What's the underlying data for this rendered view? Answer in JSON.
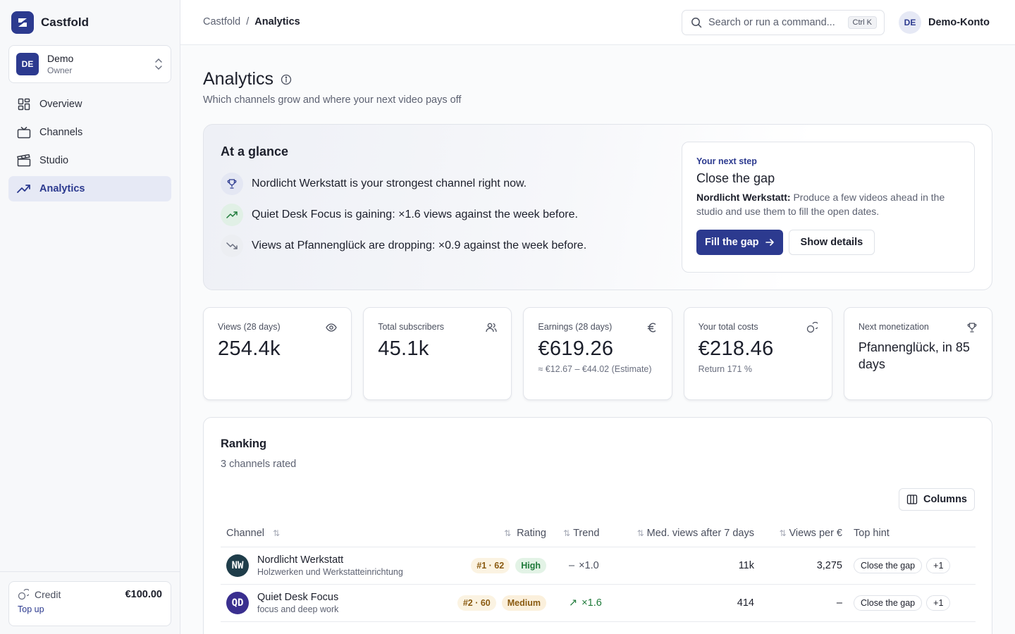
{
  "app": {
    "name": "Castfold",
    "brand_color": "#2c3a8f"
  },
  "workspace": {
    "initials": "DE",
    "name": "Demo",
    "role": "Owner"
  },
  "sidebar": {
    "items": [
      {
        "label": "Overview",
        "icon": "grid-icon"
      },
      {
        "label": "Channels",
        "icon": "tv-icon"
      },
      {
        "label": "Studio",
        "icon": "clapperboard-icon"
      },
      {
        "label": "Analytics",
        "icon": "trending-up-icon",
        "active": true
      }
    ]
  },
  "credit": {
    "label": "Credit",
    "amount": "€100.00",
    "topup": "Top up"
  },
  "breadcrumb": {
    "root": "Castfold",
    "separator": "/",
    "current": "Analytics"
  },
  "search": {
    "placeholder": "Search or run a command...",
    "shortcut": "Ctrl K"
  },
  "account": {
    "initials": "DE",
    "name": "Demo-Konto"
  },
  "page": {
    "title": "Analytics",
    "subtitle": "Which channels grow and where your next video pays off"
  },
  "glance": {
    "title": "At a glance",
    "items": [
      {
        "icon": "trophy-icon",
        "text": "Nordlicht Werkstatt is your strongest channel right now."
      },
      {
        "icon": "trending-up-icon",
        "text": "Quiet Desk Focus is gaining: ×1.6 views against the week before."
      },
      {
        "icon": "trending-down-icon",
        "text": "Views at Pfannenglück are dropping: ×0.9 against the week before."
      }
    ]
  },
  "next_step": {
    "kicker": "Your next step",
    "title": "Close the gap",
    "channel": "Nordlicht Werkstatt:",
    "body": "Produce a few videos ahead in the studio and use them to fill the open dates.",
    "primary": "Fill the gap",
    "secondary": "Show details"
  },
  "stats": [
    {
      "label": "Views (28 days)",
      "icon": "eye-icon",
      "value": "254.4k",
      "note": ""
    },
    {
      "label": "Total subscribers",
      "icon": "users-icon",
      "value": "45.1k",
      "note": ""
    },
    {
      "label": "Earnings (28 days)",
      "icon": "euro-icon",
      "value": "€619.26",
      "note": "≈ €12.67 – €44.02 (Estimate)"
    },
    {
      "label": "Your total costs",
      "icon": "coins-icon",
      "value": "€218.46",
      "note": "Return 171 %"
    },
    {
      "label": "Next monetization",
      "icon": "trophy-icon",
      "value": "Pfannenglück, in 85 days",
      "note": ""
    }
  ],
  "ranking": {
    "title": "Ranking",
    "subtitle": "3 channels rated",
    "columns_button": "Columns",
    "headers": {
      "channel": "Channel",
      "rating": "Rating",
      "trend": "Trend",
      "med_views": "Med. views after 7 days",
      "views_per_euro": "Views per €",
      "top_hint": "Top hint"
    },
    "rows": [
      {
        "initials": "NW",
        "avatar_color": "#1f3d4a",
        "name": "Nordlicht Werkstatt",
        "desc": "Holzwerken und Werkstatteinrichtung",
        "rank": "#1 · 62",
        "level": "High",
        "trend": "×1.0",
        "trend_dir": "flat",
        "med_views": "11k",
        "views_per_euro": "3,275",
        "hint": "Close the gap",
        "more": "+1"
      },
      {
        "initials": "QD",
        "avatar_color": "#3a2f8f",
        "name": "Quiet Desk Focus",
        "desc": "focus and deep work",
        "rank": "#2 · 60",
        "level": "Medium",
        "trend": "×1.6",
        "trend_dir": "up",
        "med_views": "414",
        "views_per_euro": "–",
        "hint": "Close the gap",
        "more": "+1"
      }
    ]
  }
}
